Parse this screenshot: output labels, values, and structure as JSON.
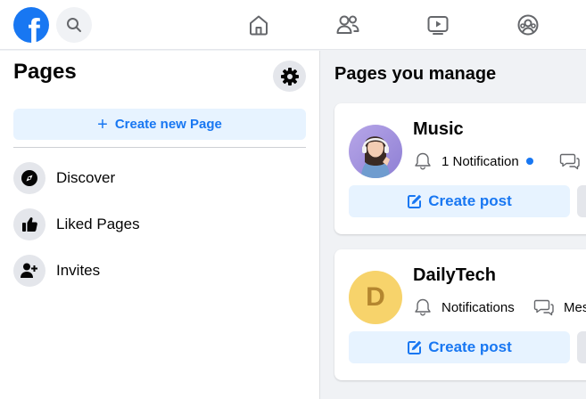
{
  "nav": {
    "logo_letter": "f",
    "tabs": [
      "home",
      "friends",
      "watch",
      "groups"
    ]
  },
  "left": {
    "title": "Pages",
    "create_label": "Create new Page",
    "create_plus": "+",
    "items": [
      {
        "label": "Discover",
        "icon": "compass-icon"
      },
      {
        "label": "Liked Pages",
        "icon": "thumbs-up-icon"
      },
      {
        "label": "Invites",
        "icon": "add-person-icon"
      }
    ]
  },
  "right": {
    "title": "Pages you manage",
    "pages": [
      {
        "name": "Music",
        "notification": "1 Notification",
        "has_unread": true,
        "message": "",
        "post_label": "Create post"
      },
      {
        "name": "DailyTech",
        "avatar_letter": "D",
        "notification": "Notifications",
        "message": "Mes",
        "post_label": "Create post"
      }
    ]
  },
  "colors": {
    "brand": "#1877f2",
    "light_blue": "#e7f3ff",
    "background": "#f0f2f5"
  }
}
